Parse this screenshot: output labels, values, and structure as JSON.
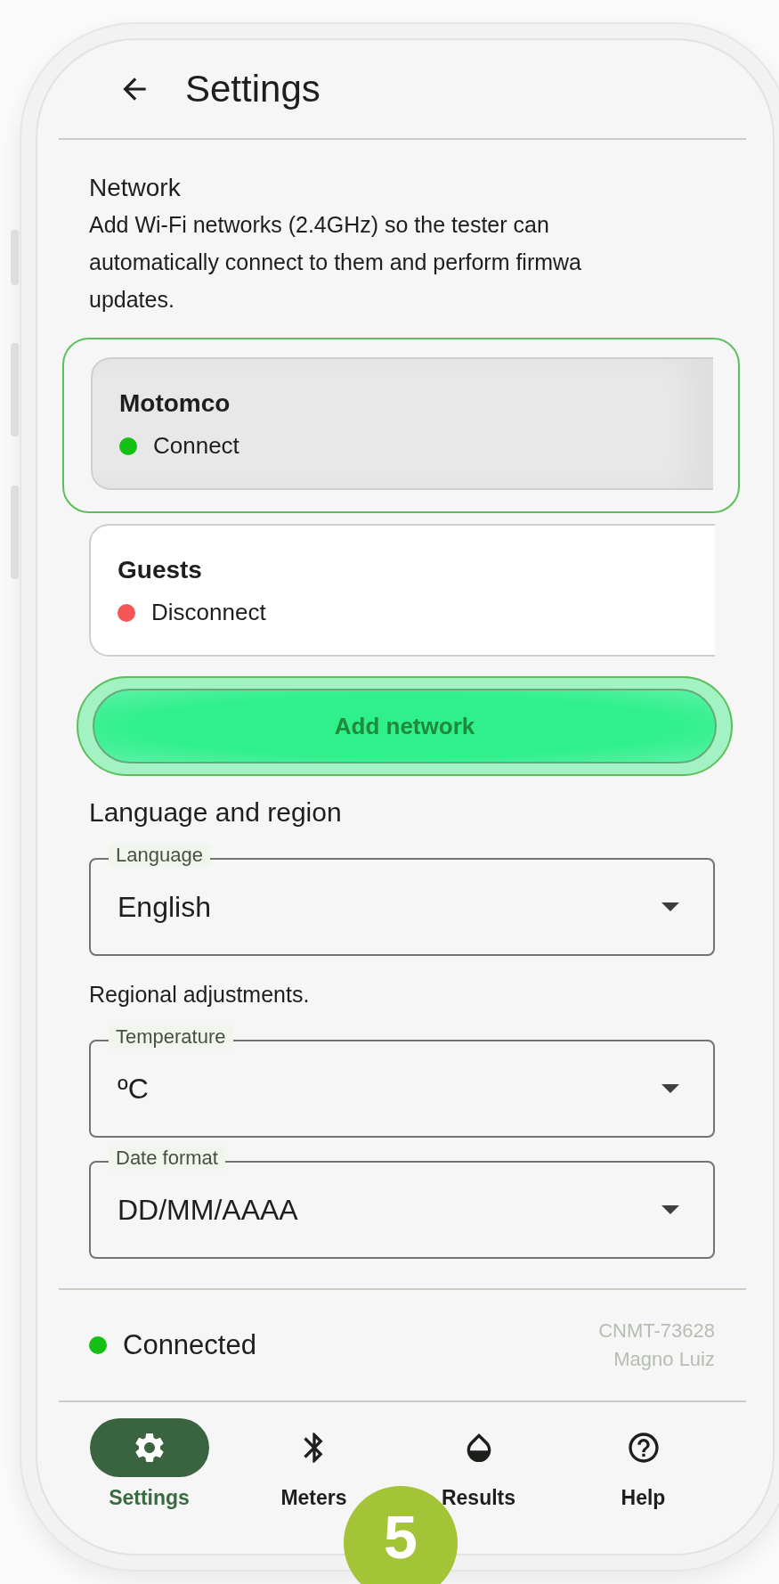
{
  "header": {
    "title": "Settings"
  },
  "network": {
    "title": "Network",
    "description": "Add Wi-Fi networks (2.4GHz) so the tester can\nautomatically connect to them and perform firmwa\nupdates.",
    "add_button": "Add network",
    "networks": [
      {
        "name": "Motomco",
        "status": "Connect",
        "color": "#13c013",
        "selected": true
      },
      {
        "name": "Guests",
        "status": "Disconnect",
        "color": "#f45555",
        "selected": false
      }
    ]
  },
  "language_region": {
    "title": "Language and region",
    "language_field": {
      "label": "Language",
      "value": "English"
    },
    "note": "Regional adjustments.",
    "regional_fields": [
      {
        "label": "Temperature",
        "value": "ºC"
      },
      {
        "label": "Date format",
        "value": "DD/MM/AAAA"
      }
    ]
  },
  "status_bar": {
    "status": "Connected",
    "color": "#13c013",
    "device": "CNMT-73628",
    "user": "Magno Luiz"
  },
  "nav": [
    {
      "label": "Settings",
      "selected": true
    },
    {
      "label": "Meters",
      "selected": false
    },
    {
      "label": "Results",
      "selected": false
    },
    {
      "label": "Help",
      "selected": false
    }
  ],
  "step_badge": "5"
}
